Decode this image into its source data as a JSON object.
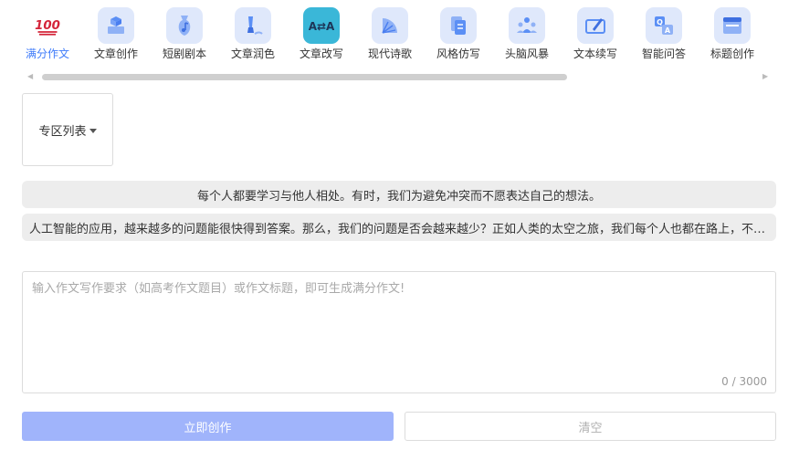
{
  "toolbar": {
    "items": [
      {
        "label": "满分作文",
        "icon": "hundred-points-icon",
        "active": true
      },
      {
        "label": "文章创作",
        "icon": "cube-book-icon"
      },
      {
        "label": "短剧剧本",
        "icon": "vase-note-icon"
      },
      {
        "label": "文章润色",
        "icon": "brush-icon"
      },
      {
        "label": "文章改写",
        "icon": "translate-icon"
      },
      {
        "label": "现代诗歌",
        "icon": "fan-icon"
      },
      {
        "label": "风格仿写",
        "icon": "copy-icon"
      },
      {
        "label": "头脑风暴",
        "icon": "team-icon"
      },
      {
        "label": "文本续写",
        "icon": "edit-box-icon"
      },
      {
        "label": "智能问答",
        "icon": "qa-icon"
      },
      {
        "label": "标题创作",
        "icon": "window-title-icon"
      }
    ]
  },
  "zone": {
    "label": "专区列表"
  },
  "suggestions": [
    "每个人都要学习与他人相处。有时，我们为避免冲突而不愿表达自己的想法。",
    "人工智能的应用，越来越多的问题能很快得到答案。那么，我们的问题是否会越来越少？正如人类的太空之旅，我们每个人也都在路上，不断探索与发现。"
  ],
  "input": {
    "placeholder": "输入作文写作要求（如高考作文题目）或作文标题，即可生成满分作文!",
    "value": "",
    "counter": "0 / 3000"
  },
  "actions": {
    "create_label": "立即创作",
    "clear_label": "清空"
  },
  "colors": {
    "accent": "#3e7bfa",
    "icon_bg": "#dfe8fb",
    "primary_button": "#a0b4fb",
    "chip_bg": "#ededed"
  }
}
